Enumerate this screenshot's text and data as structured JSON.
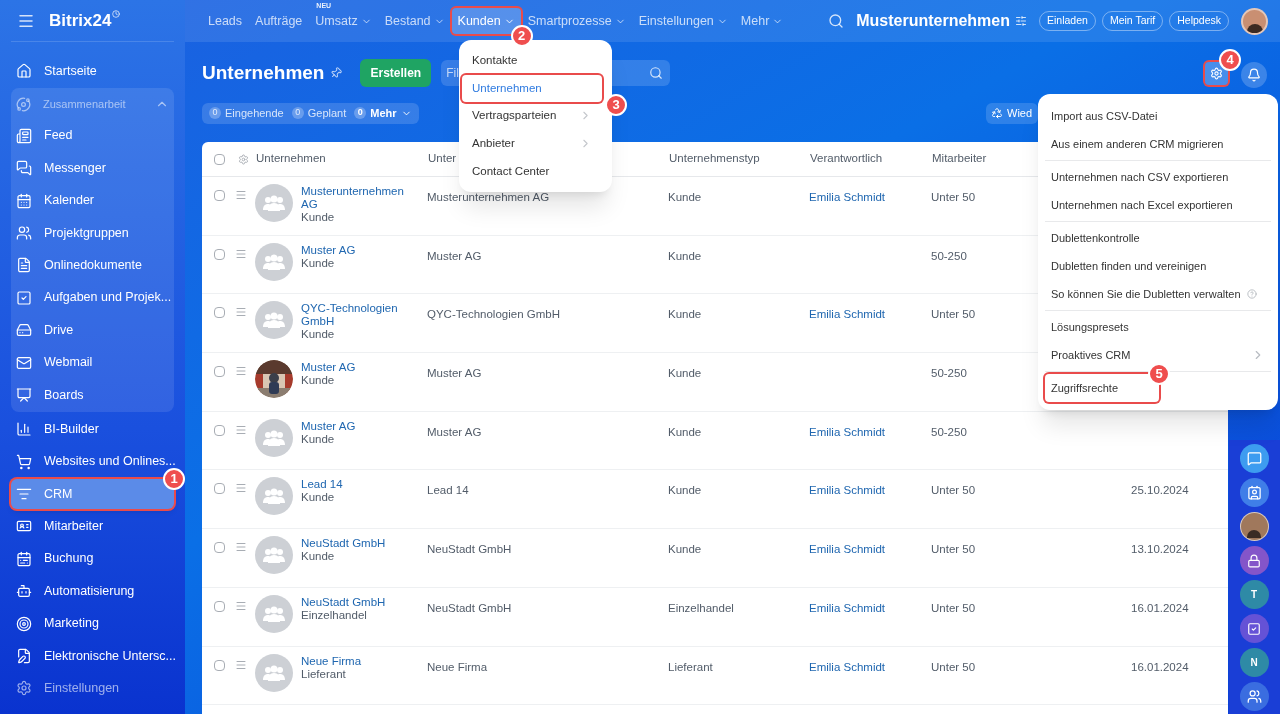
{
  "sidebar": {
    "brand": "Bitrix24",
    "items": [
      {
        "label": "Startseite",
        "selected": false
      },
      {
        "kind": "group",
        "label": "Zusammenarbeit",
        "expanded": true,
        "children": [
          {
            "label": "Feed",
            "selected": false
          },
          {
            "label": "Messenger",
            "selected": false
          },
          {
            "label": "Kalender",
            "selected": false
          },
          {
            "label": "Projektgruppen",
            "selected": false
          },
          {
            "label": "Onlinedokumente",
            "selected": false
          },
          {
            "label": "Aufgaben und Projek...",
            "selected": false
          },
          {
            "label": "Drive",
            "selected": false
          },
          {
            "label": "Webmail",
            "selected": false
          },
          {
            "label": "Boards",
            "selected": false
          }
        ]
      },
      {
        "label": "BI-Builder",
        "selected": false
      },
      {
        "label": "Websites und Onlines...",
        "selected": false
      },
      {
        "label": "CRM",
        "selected": true,
        "callout": "1"
      },
      {
        "label": "Mitarbeiter",
        "selected": false
      },
      {
        "label": "Buchung",
        "selected": false
      },
      {
        "label": "Automatisierung",
        "selected": false
      },
      {
        "label": "Marketing",
        "selected": false
      },
      {
        "label": "Elektronische Untersc...",
        "selected": false
      },
      {
        "label": "Einstellungen",
        "selected": false,
        "dimmed": true
      }
    ]
  },
  "topbar": {
    "nav": [
      {
        "label": "Leads",
        "dropdown": false,
        "selected": false
      },
      {
        "label": "Aufträge",
        "dropdown": false,
        "selected": false
      },
      {
        "label": "Umsatz",
        "dropdown": true,
        "selected": false,
        "badge": "NEU"
      },
      {
        "label": "Bestand",
        "dropdown": true,
        "selected": false
      },
      {
        "label": "Kunden",
        "dropdown": true,
        "selected": true,
        "callout": "2"
      },
      {
        "label": "Smartprozesse",
        "dropdown": true,
        "selected": false
      },
      {
        "label": "Einstellungen",
        "dropdown": true,
        "selected": false
      },
      {
        "label": "Mehr",
        "dropdown": true,
        "selected": false
      }
    ],
    "company": "Musterunternehmen",
    "buttons": [
      "Einladen",
      "Mein Tarif",
      "Helpdesk"
    ]
  },
  "header": {
    "title": "Unternehmen",
    "create_button": "Erstellen",
    "filter": {
      "placeholder": "Fil"
    },
    "settings_callout": "4",
    "counters": [
      {
        "count": "0",
        "label": "Eingehende",
        "dropdown": false
      },
      {
        "count": "0",
        "label": "Geplant",
        "dropdown": false
      },
      {
        "count": "0",
        "label": "Mehr",
        "dropdown": true
      }
    ],
    "right_button": "Wied"
  },
  "table": {
    "select_all": {
      "checked": false
    },
    "columns": [
      "Unternehmen",
      "Unter",
      "Unternehmenstyp",
      "Verantwortlich",
      "Mitarbeiter"
    ],
    "rows": [
      {
        "checked": false,
        "name": "Musterunternehmen AG",
        "subtype": "Kunde",
        "kind": "placeholder",
        "company": "Musterunternehmen AG",
        "type": "Kunde",
        "responsible": "Emilia Schmidt",
        "employees": "Unter 50"
      },
      {
        "checked": false,
        "name": "Muster AG",
        "subtype": "Kunde",
        "kind": "placeholder",
        "company": "Muster AG",
        "type": "Kunde",
        "employees": "50-250"
      },
      {
        "checked": false,
        "name": "QYC-Technologien GmbH",
        "subtype": "Kunde",
        "kind": "placeholder",
        "company": "QYC-Technologien GmbH",
        "type": "Kunde",
        "responsible": "Emilia Schmidt",
        "employees": "Unter 50"
      },
      {
        "checked": false,
        "name": "Muster AG",
        "subtype": "Kunde",
        "company": "Muster AG",
        "type": "Kunde",
        "employees": "50-250"
      },
      {
        "checked": false,
        "name": "Muster AG",
        "subtype": "Kunde",
        "kind": "placeholder",
        "company": "Muster AG",
        "type": "Kunde",
        "responsible": "Emilia Schmidt",
        "employees": "50-250"
      },
      {
        "checked": false,
        "name": "Lead 14",
        "subtype": "Kunde",
        "kind": "placeholder",
        "company": "Lead 14",
        "type": "Kunde",
        "responsible": "Emilia Schmidt",
        "employees": "Unter 50",
        "date": "25.10.2024"
      },
      {
        "checked": false,
        "name": "NeuStadt GmbH",
        "subtype": "Kunde",
        "kind": "placeholder",
        "company": "NeuStadt GmbH",
        "type": "Kunde",
        "responsible": "Emilia Schmidt",
        "employees": "Unter 50",
        "date": "13.10.2024"
      },
      {
        "checked": false,
        "name": "NeuStadt GmbH",
        "subtype": "Einzelhandel",
        "kind": "placeholder",
        "company": "NeuStadt GmbH",
        "type": "Einzelhandel",
        "responsible": "Emilia Schmidt",
        "employees": "Unter 50",
        "date": "16.01.2024"
      },
      {
        "checked": false,
        "name": "Neue Firma",
        "subtype": "Lieferant",
        "kind": "placeholder",
        "company": "Neue Firma",
        "type": "Lieferant",
        "responsible": "Emilia Schmidt",
        "employees": "Unter 50",
        "date": "16.01.2024"
      }
    ]
  },
  "kunden_menu": [
    {
      "label": "Kontakte",
      "selected": false,
      "submenu": false
    },
    {
      "label": "Unternehmen",
      "selected": true,
      "submenu": false,
      "callout": "3"
    },
    {
      "label": "Vertragsparteien",
      "selected": false,
      "submenu": true
    },
    {
      "label": "Anbieter",
      "selected": false,
      "submenu": true
    },
    {
      "label": "Contact Center",
      "selected": false,
      "submenu": false
    }
  ],
  "settings_menu": [
    [
      {
        "label": "Import aus CSV-Datei",
        "kind": "plain"
      },
      {
        "label": "Aus einem anderen CRM migrieren",
        "kind": "plain"
      }
    ],
    [
      {
        "label": "Unternehmen nach CSV exportieren",
        "kind": "plain"
      },
      {
        "label": "Unternehmen nach Excel exportieren",
        "kind": "plain"
      }
    ],
    [
      {
        "label": "Dublettenkontrolle",
        "kind": "plain"
      },
      {
        "label": "Dubletten finden und vereinigen",
        "kind": "plain"
      },
      {
        "label": "So können Sie die Dubletten verwalten",
        "kind": "help"
      }
    ],
    [
      {
        "label": "Lösungspresets",
        "kind": "plain"
      },
      {
        "label": "Proaktives CRM",
        "kind": "submenu"
      }
    ],
    [
      {
        "label": "Zugriffsrechte",
        "kind": "plain",
        "callout": "5"
      }
    ]
  ],
  "rail": [
    {
      "kind": "chat",
      "color": "#3d9cf0"
    },
    {
      "kind": "card",
      "color": "#3f7ee8"
    },
    {
      "kind": "avatar"
    },
    {
      "kind": "lock",
      "color": "#8455c9"
    },
    {
      "kind": "letter",
      "letter": "T",
      "color": "#2e8aa6"
    },
    {
      "kind": "task",
      "color": "#6552d6"
    },
    {
      "kind": "letter",
      "letter": "N",
      "color": "#2e8aa6"
    },
    {
      "kind": "group",
      "color": "#3a6de0"
    }
  ]
}
